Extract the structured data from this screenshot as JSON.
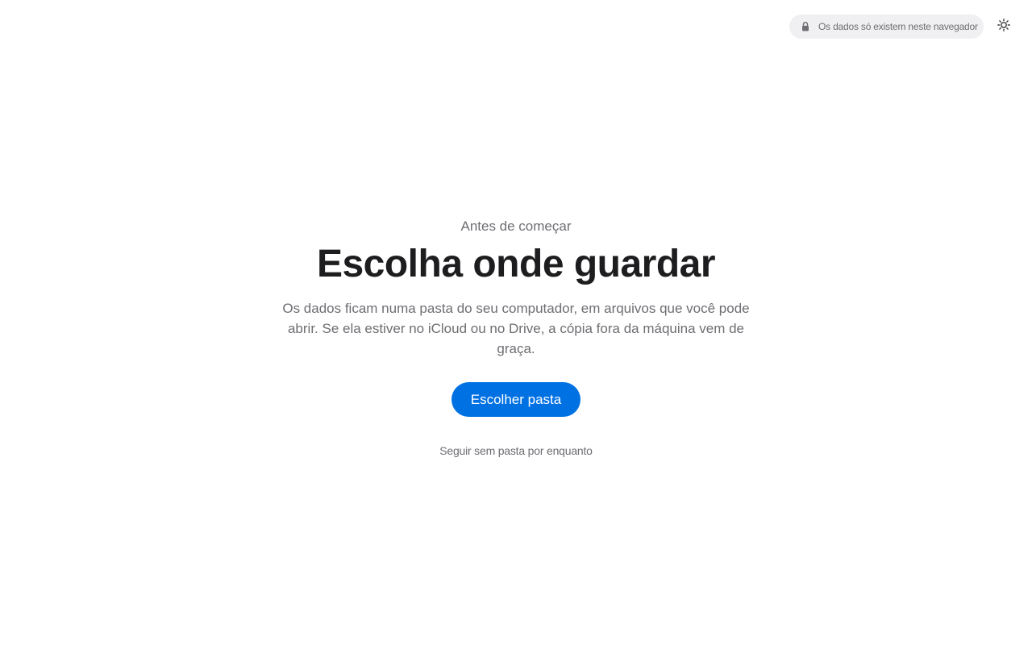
{
  "header": {
    "privacy_notice": "Os dados só existem neste navegador",
    "privacy_icon": "lock-icon",
    "theme_icon": "sun-icon"
  },
  "onboarding": {
    "eyebrow": "Antes de começar",
    "title": "Escolha onde guardar",
    "description": "Os dados ficam numa pasta do seu computador, em arquivos que você pode abrir. Se ela estiver no iCloud ou no Drive, a cópia fora da máquina vem de graça.",
    "primary_button_label": "Escolher pasta",
    "secondary_link_label": "Seguir sem pasta por enquanto"
  },
  "colors": {
    "accent": "#0071e3",
    "pill_background": "#f0f0f2",
    "muted_text": "#6e6e73",
    "heading_text": "#1d1d1f"
  }
}
